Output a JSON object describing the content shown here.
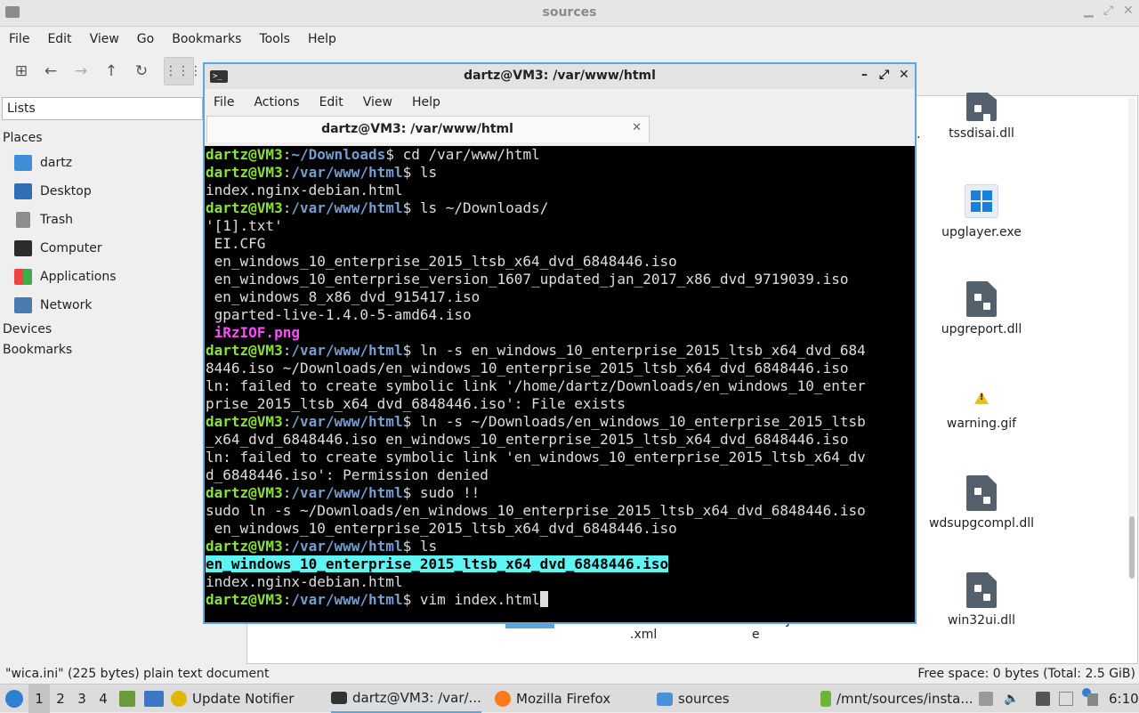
{
  "file_manager": {
    "title": "sources",
    "menu": [
      "File",
      "Edit",
      "View",
      "Go",
      "Bookmarks",
      "Tools",
      "Help"
    ],
    "sidebar": {
      "combo": "Lists",
      "places_heading": "Places",
      "places": [
        "dartz",
        "Desktop",
        "Trash",
        "Computer",
        "Applications",
        "Network"
      ],
      "devices_heading": "Devices",
      "bookmarks_heading": "Bookmarks"
    },
    "files": [
      "tssdisai.dll",
      "upglayer.exe",
      "upgreport.dll",
      "warning.gif",
      "wdsupgcompl.dll",
      "win32ui.dll"
    ],
    "partial_labels": [
      ".",
      ".xml",
      "e",
      "y"
    ],
    "status_left": "\"wica.ini\" (225 bytes) plain text document",
    "status_right": "Free space: 0 bytes (Total: 2.5 GiB)"
  },
  "terminal": {
    "title": "dartz@VM3: /var/www/html",
    "menu": [
      "File",
      "Actions",
      "Edit",
      "View",
      "Help"
    ],
    "tab_label": "dartz@VM3: /var/www/html",
    "prompt_user": "dartz@VM3",
    "lines": [
      {
        "type": "prompt",
        "path": "~/Downloads",
        "cmd": " cd /var/www/html"
      },
      {
        "type": "prompt",
        "path": "/var/www/html",
        "cmd": " ls"
      },
      {
        "type": "out",
        "text": "index.nginx-debian.html"
      },
      {
        "type": "prompt",
        "path": "/var/www/html",
        "cmd": " ls ~/Downloads/"
      },
      {
        "type": "out",
        "text": "'[1].txt'"
      },
      {
        "type": "out",
        "text": " EI.CFG"
      },
      {
        "type": "out",
        "text": " en_windows_10_enterprise_2015_ltsb_x64_dvd_6848446.iso"
      },
      {
        "type": "out",
        "text": " en_windows_10_enterprise_version_1607_updated_jan_2017_x86_dvd_9719039.iso"
      },
      {
        "type": "out",
        "text": " en_windows_8_x86_dvd_915417.iso"
      },
      {
        "type": "out",
        "text": " gparted-live-1.4.0-5-amd64.iso"
      },
      {
        "type": "mag",
        "text": " iRzIOF.png"
      },
      {
        "type": "prompt",
        "path": "/var/www/html",
        "cmd": " ln -s en_windows_10_enterprise_2015_ltsb_x64_dvd_684"
      },
      {
        "type": "out",
        "text": "8446.iso ~/Downloads/en_windows_10_enterprise_2015_ltsb_x64_dvd_6848446.iso"
      },
      {
        "type": "out",
        "text": "ln: failed to create symbolic link '/home/dartz/Downloads/en_windows_10_enter"
      },
      {
        "type": "out",
        "text": "prise_2015_ltsb_x64_dvd_6848446.iso': File exists"
      },
      {
        "type": "prompt",
        "path": "/var/www/html",
        "cmd": " ln -s ~/Downloads/en_windows_10_enterprise_2015_ltsb"
      },
      {
        "type": "out",
        "text": "_x64_dvd_6848446.iso en_windows_10_enterprise_2015_ltsb_x64_dvd_6848446.iso"
      },
      {
        "type": "out",
        "text": "ln: failed to create symbolic link 'en_windows_10_enterprise_2015_ltsb_x64_dv"
      },
      {
        "type": "out",
        "text": "d_6848446.iso': Permission denied"
      },
      {
        "type": "prompt",
        "path": "/var/www/html",
        "cmd": " sudo !!"
      },
      {
        "type": "out",
        "text": "sudo ln -s ~/Downloads/en_windows_10_enterprise_2015_ltsb_x64_dvd_6848446.iso"
      },
      {
        "type": "out",
        "text": " en_windows_10_enterprise_2015_ltsb_x64_dvd_6848446.iso"
      },
      {
        "type": "prompt",
        "path": "/var/www/html",
        "cmd": " ls"
      },
      {
        "type": "hl",
        "text": "en_windows_10_enterprise_2015_ltsb_x64_dvd_6848446.iso"
      },
      {
        "type": "out",
        "text": "index.nginx-debian.html"
      },
      {
        "type": "prompt",
        "path": "/var/www/html",
        "cmd": " vim index.html",
        "cursor": true
      }
    ]
  },
  "taskbar": {
    "workspaces": [
      "1",
      "2",
      "3",
      "4"
    ],
    "tasks": [
      "Update Notifier",
      "dartz@VM3: /var/...",
      "Mozilla Firefox",
      "sources",
      "/mnt/sources/insta..."
    ],
    "clock": "6:10"
  },
  "colors": {
    "prompt_user": "#8ae234",
    "prompt_path": "#729fcf",
    "highlight": "#5ff4f4",
    "accent": "#5aa7de"
  }
}
